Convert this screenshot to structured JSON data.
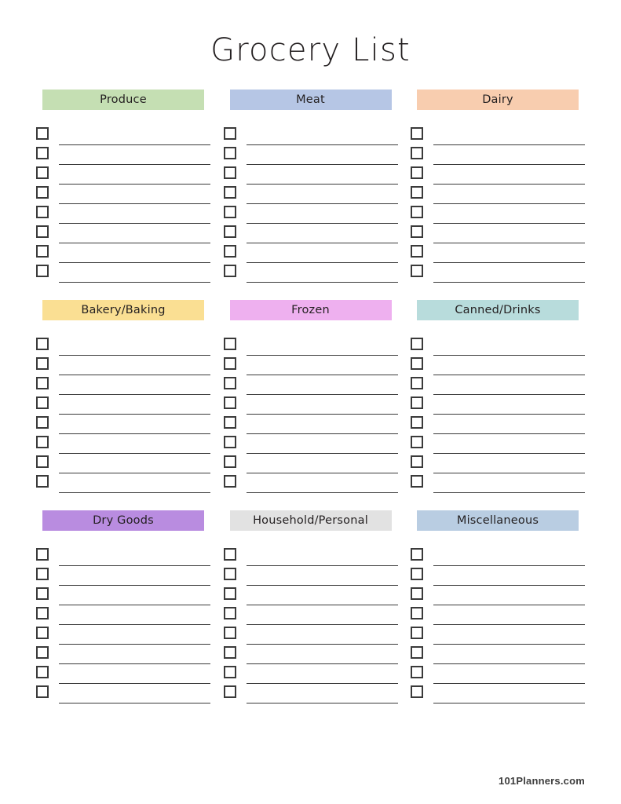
{
  "document": {
    "title": "Grocery List",
    "footer": "101Planners.com",
    "rows_per_section": 8
  },
  "sections": [
    [
      {
        "label": "Produce",
        "color": "#c5dfb3"
      },
      {
        "label": "Meat",
        "color": "#b6c6e5"
      },
      {
        "label": "Dairy",
        "color": "#f8cdaf"
      }
    ],
    [
      {
        "label": "Bakery/Baking",
        "color": "#fadf93"
      },
      {
        "label": "Frozen",
        "color": "#eeb0ef"
      },
      {
        "label": "Canned/Drinks",
        "color": "#b8dcdc"
      }
    ],
    [
      {
        "label": "Dry Goods",
        "color": "#b98ce0"
      },
      {
        "label": "Household/Personal",
        "color": "#e2e2e2"
      },
      {
        "label": "Miscellaneous",
        "color": "#b9cde2"
      }
    ]
  ]
}
